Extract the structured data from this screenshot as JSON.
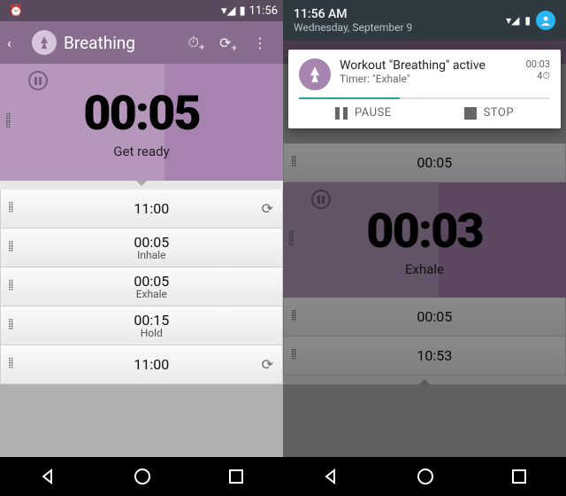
{
  "left": {
    "status": {
      "time": "11:56"
    },
    "appbar": {
      "title": "Breathing"
    },
    "hero": {
      "time": "00:05",
      "label": "Get ready"
    },
    "rows": [
      {
        "time": "11:00",
        "sub": "",
        "loop": true
      },
      {
        "time": "00:05",
        "sub": "Inhale",
        "loop": false
      },
      {
        "time": "00:05",
        "sub": "Exhale",
        "loop": false
      },
      {
        "time": "00:15",
        "sub": "Hold",
        "loop": false
      },
      {
        "time": "11:00",
        "sub": "",
        "loop": true
      }
    ]
  },
  "right": {
    "panel": {
      "time": "11:56 AM",
      "date": "Wednesday, September 9"
    },
    "notif": {
      "title": "Workout \"Breathing\" active",
      "sub": "Timer: \"Exhale\"",
      "elapsed": "00:03",
      "count": "4⏱",
      "pause": "PAUSE",
      "stop": "STOP"
    },
    "hero": {
      "time": "00:03",
      "label": "Exhale"
    },
    "rows": [
      {
        "time": "00:05",
        "sub": ""
      },
      {
        "time": "00:05",
        "sub": ""
      },
      {
        "time": "10:53",
        "sub": ""
      }
    ]
  }
}
